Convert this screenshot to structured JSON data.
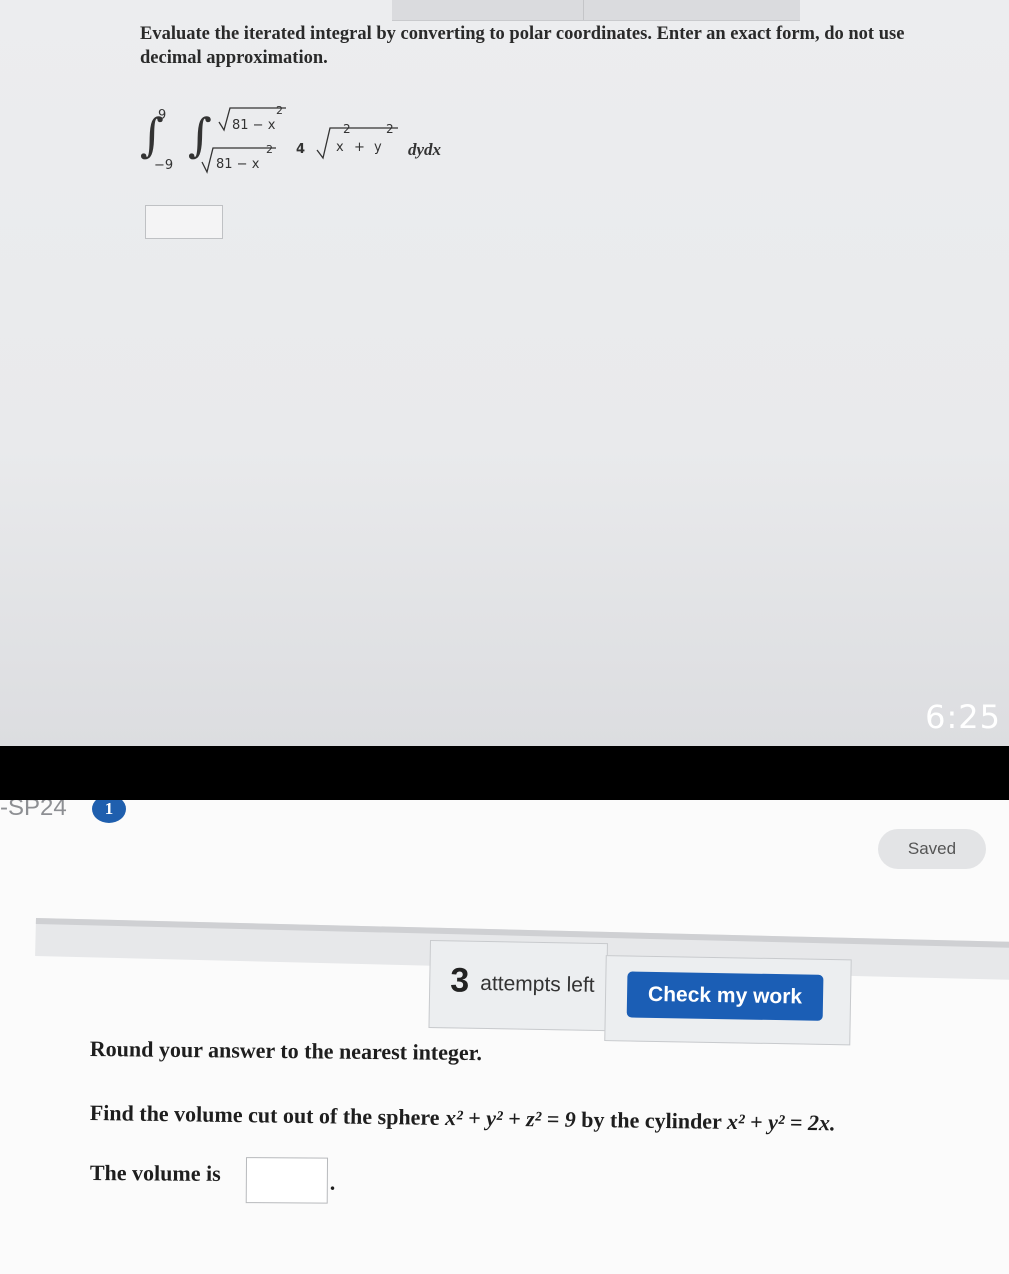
{
  "question1": {
    "prompt_line1": "Evaluate the iterated integral by converting to polar coordinates. Enter an exact form, do not use",
    "prompt_line2": "decimal approximation.",
    "integral": {
      "outer_upper": "9",
      "outer_lower": "−9",
      "inner_upper": "81 − x",
      "inner_lower": "81 − x",
      "exp2": "2",
      "coef": "4",
      "radicand_x": "x",
      "radicand_plus": "+",
      "radicand_y": "y",
      "differential": "dydx"
    },
    "answer_value": ""
  },
  "status_bar": {
    "clock": "6:25"
  },
  "header": {
    "course_tag": "-SP24",
    "badge_count": "1",
    "saved_label": "Saved"
  },
  "attempts": {
    "count": "3",
    "label": "attempts left",
    "check_button": "Check my work"
  },
  "question2": {
    "instruction": "Round your answer to the nearest integer.",
    "find_prefix": "Find the volume cut out of the sphere",
    "sphere_eq": "x² + y² + z² = 9",
    "by_the_cylinder": "by the cylinder",
    "cylinder_eq": "x² + y² = 2x.",
    "volume_label": "The volume is",
    "answer_value": "",
    "period": "."
  },
  "colors": {
    "accent": "#1b5eb5",
    "badge": "#1f5fae",
    "text": "#1e1e1e"
  }
}
